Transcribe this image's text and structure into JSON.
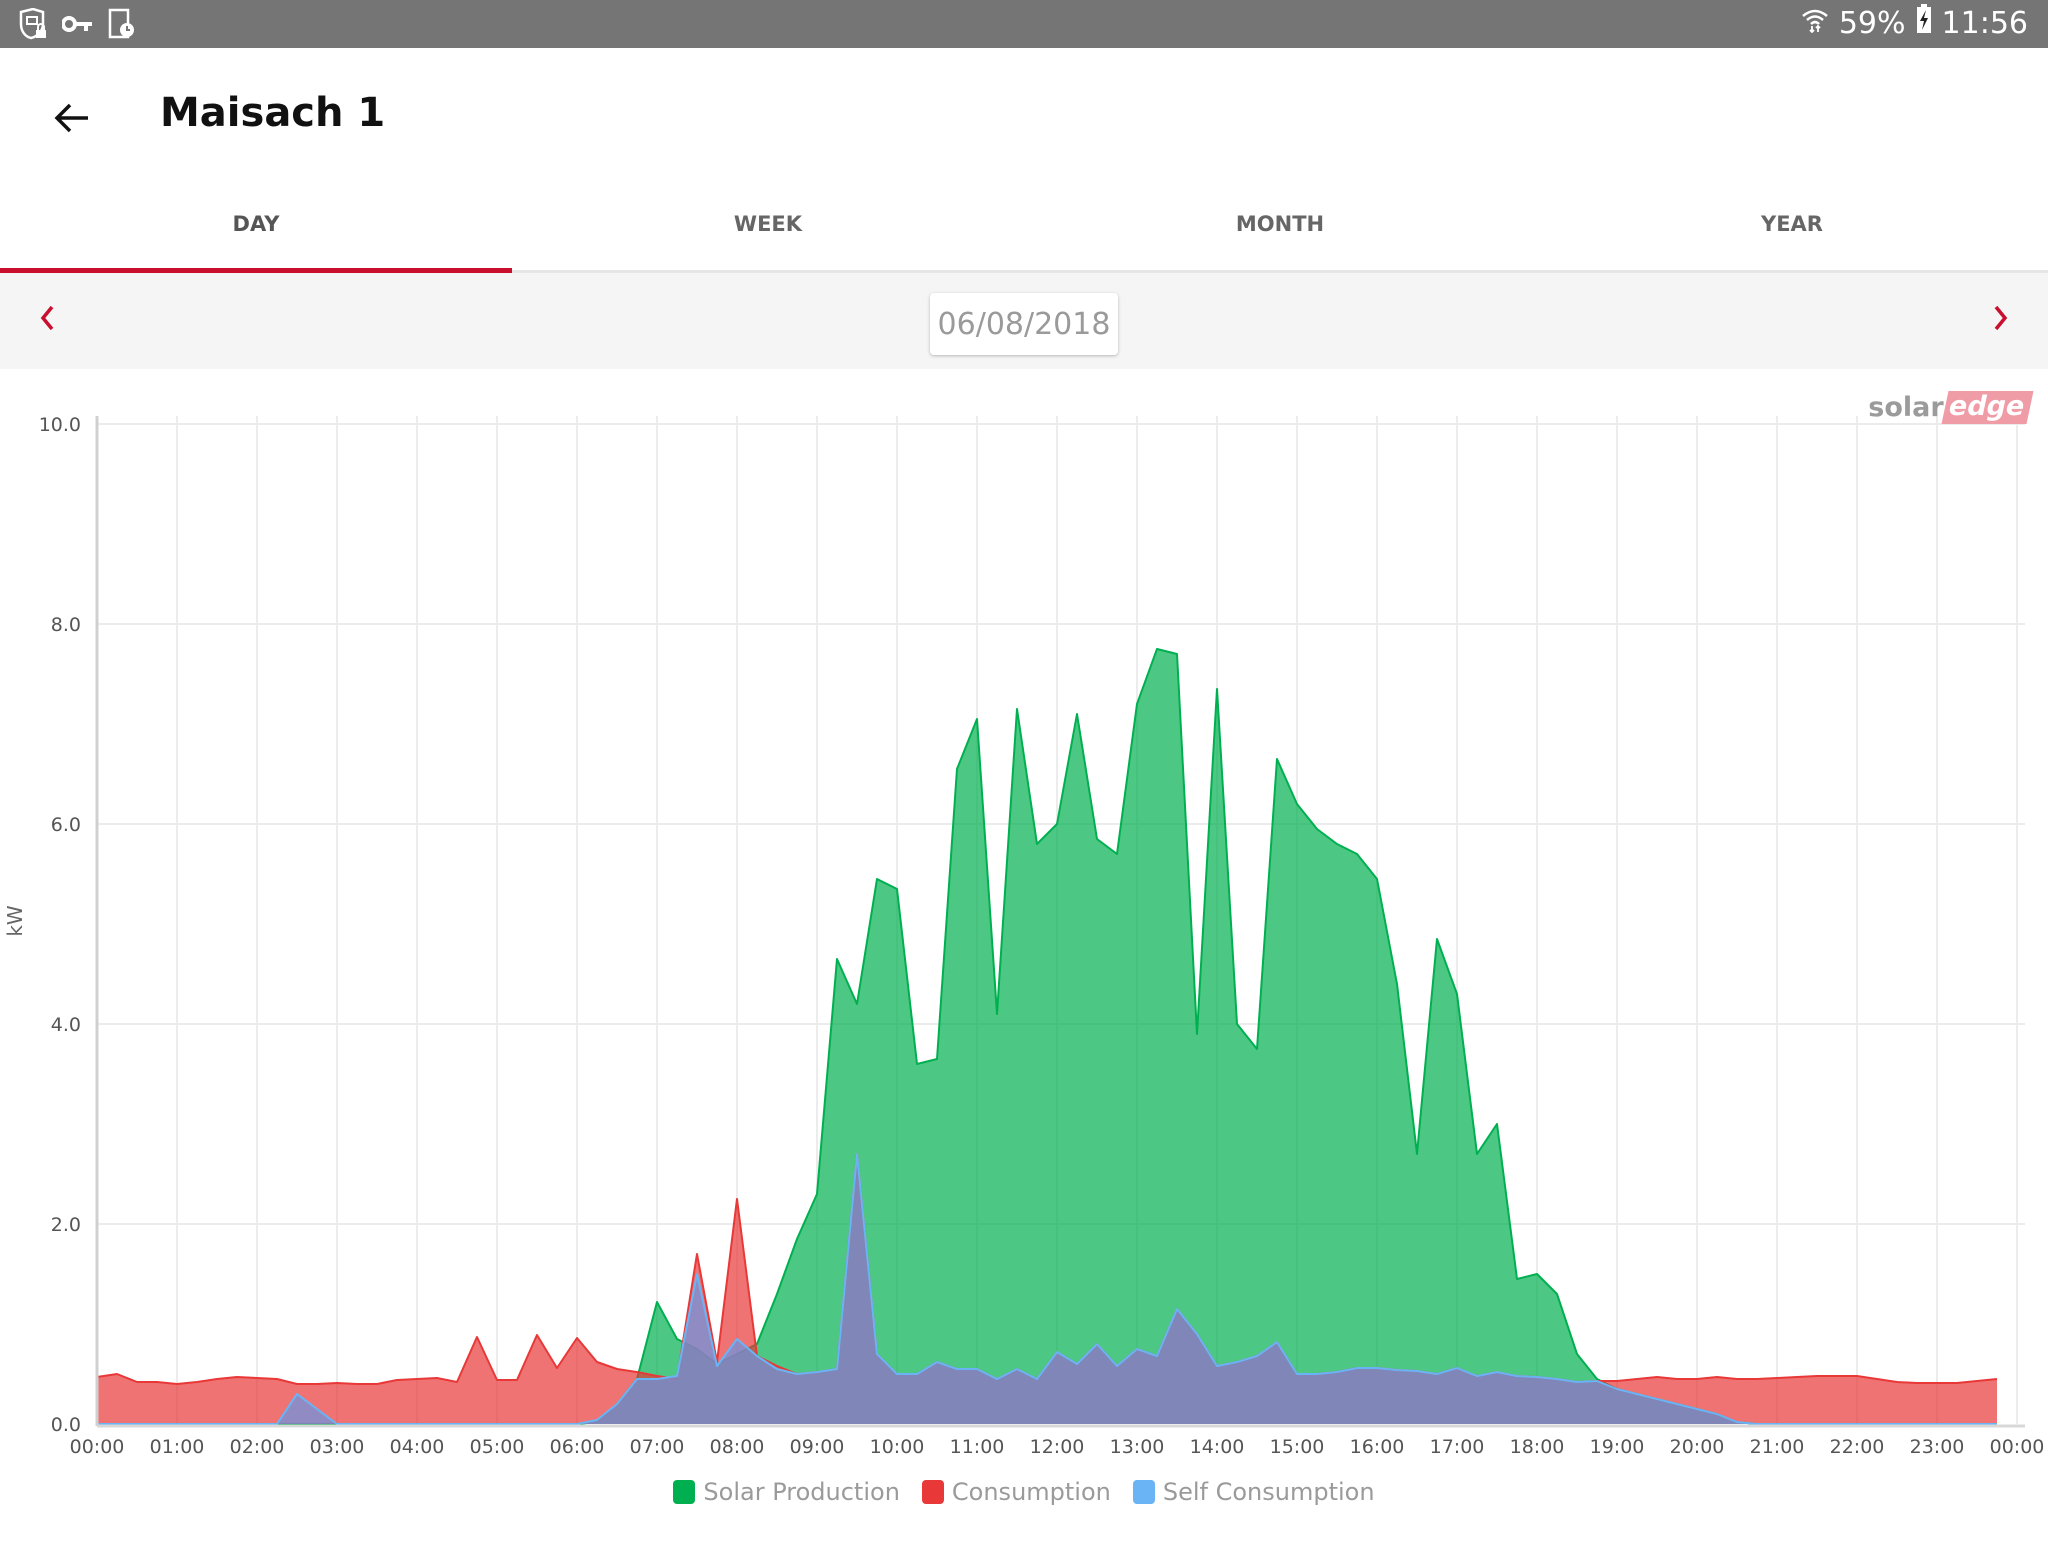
{
  "status_bar": {
    "left_icons": [
      "vpn-shield-lock-icon",
      "key-icon",
      "device-clock-icon"
    ],
    "wifi_icon": "wifi-icon",
    "battery_percent": "59%",
    "battery_icon": "battery-charging-icon",
    "time": "11:56"
  },
  "app_bar": {
    "back_icon": "arrow-left-icon",
    "title": "Maisach 1"
  },
  "tabs": [
    {
      "label": "DAY",
      "active": true
    },
    {
      "label": "WEEK",
      "active": false
    },
    {
      "label": "MONTH",
      "active": false
    },
    {
      "label": "YEAR",
      "active": false
    }
  ],
  "date_nav": {
    "prev_icon": "chevron-left-icon",
    "next_icon": "chevron-right-icon",
    "date": "06/08/2018"
  },
  "colors": {
    "accent": "#c8102e",
    "solar": "#00b050",
    "consumption": "#e83838",
    "self_consumption": "#6ab4f5"
  },
  "logo": {
    "part1": "solar",
    "part2": "edge"
  },
  "chart_data": {
    "type": "area",
    "title": "",
    "xlabel": "",
    "ylabel": "kW",
    "ylim": [
      0,
      10
    ],
    "yticks": [
      "0.0",
      "2.0",
      "4.0",
      "6.0",
      "8.0",
      "10.0"
    ],
    "ytick_values": [
      0,
      2,
      4,
      6,
      8,
      10
    ],
    "xticks": [
      "00:00",
      "01:00",
      "02:00",
      "03:00",
      "04:00",
      "05:00",
      "06:00",
      "07:00",
      "08:00",
      "09:00",
      "10:00",
      "11:00",
      "12:00",
      "13:00",
      "14:00",
      "15:00",
      "16:00",
      "17:00",
      "18:00",
      "19:00",
      "20:00",
      "21:00",
      "22:00",
      "23:00",
      "00:00"
    ],
    "x_interval_minutes": 15,
    "grid": true,
    "legend_position": "bottom",
    "series": [
      {
        "name": "Solar Production",
        "color": "#00b050",
        "values": [
          0,
          0,
          0,
          0,
          0,
          0,
          0,
          0,
          0,
          0,
          0,
          0,
          0,
          0,
          0,
          0,
          0,
          0,
          0,
          0,
          0,
          0,
          0,
          0,
          0,
          0.02,
          0.2,
          0.45,
          1.22,
          0.85,
          0.75,
          0.6,
          0.7,
          0.8,
          1.3,
          1.85,
          2.3,
          4.65,
          4.2,
          5.45,
          5.35,
          3.6,
          3.65,
          6.55,
          7.05,
          4.1,
          7.15,
          5.8,
          6.0,
          7.1,
          5.85,
          5.7,
          7.2,
          7.75,
          7.7,
          3.9,
          7.35,
          4.0,
          3.75,
          6.65,
          6.2,
          5.95,
          5.8,
          5.7,
          5.45,
          4.4,
          2.7,
          4.85,
          4.3,
          2.7,
          3.0,
          1.45,
          1.5,
          1.3,
          0.7,
          0.45,
          0.35,
          0.3,
          0.25,
          0.2,
          0.15,
          0.1,
          0.02,
          0,
          0,
          0,
          0,
          0,
          0,
          0,
          0,
          0
        ]
      },
      {
        "name": "Consumption",
        "color": "#e83838",
        "values": [
          0.47,
          0.5,
          0.42,
          0.42,
          0.4,
          0.42,
          0.45,
          0.47,
          0.46,
          0.45,
          0.4,
          0.4,
          0.41,
          0.4,
          0.4,
          0.44,
          0.45,
          0.46,
          0.42,
          0.87,
          0.44,
          0.44,
          0.89,
          0.56,
          0.86,
          0.62,
          0.55,
          0.52,
          0.48,
          0.45,
          1.7,
          0.62,
          2.25,
          0.68,
          0.58,
          0.5,
          0.52,
          0.55,
          2.7,
          0.7,
          0.5,
          0.5,
          0.62,
          0.55,
          0.55,
          0.45,
          0.55,
          0.45,
          0.72,
          0.6,
          0.8,
          0.58,
          0.75,
          0.68,
          1.15,
          0.9,
          0.58,
          0.62,
          0.68,
          0.82,
          0.5,
          0.5,
          0.52,
          0.56,
          0.56,
          0.54,
          0.53,
          0.5,
          0.56,
          0.48,
          0.52,
          0.48,
          0.47,
          0.45,
          0.42,
          0.43,
          0.43,
          0.45,
          0.47,
          0.45,
          0.45,
          0.47,
          0.45,
          0.45,
          0.46,
          0.47,
          0.48,
          0.48,
          0.48,
          0.45,
          0.42,
          0.41,
          0.41,
          0.41,
          0.43,
          0.45
        ]
      },
      {
        "name": "Self Consumption",
        "color": "#6ab4f5",
        "values": [
          0,
          0,
          0,
          0,
          0,
          0,
          0,
          0,
          0,
          0,
          0.3,
          0.15,
          0,
          0,
          0,
          0,
          0,
          0,
          0,
          0,
          0,
          0,
          0,
          0,
          0,
          0.04,
          0.2,
          0.45,
          0.45,
          0.48,
          1.5,
          0.58,
          0.85,
          0.68,
          0.55,
          0.5,
          0.52,
          0.55,
          2.7,
          0.7,
          0.5,
          0.5,
          0.62,
          0.55,
          0.55,
          0.45,
          0.55,
          0.45,
          0.72,
          0.6,
          0.8,
          0.58,
          0.75,
          0.68,
          1.15,
          0.9,
          0.58,
          0.62,
          0.68,
          0.82,
          0.5,
          0.5,
          0.52,
          0.56,
          0.56,
          0.54,
          0.53,
          0.5,
          0.56,
          0.48,
          0.52,
          0.48,
          0.47,
          0.45,
          0.42,
          0.43,
          0.35,
          0.3,
          0.25,
          0.2,
          0.15,
          0.1,
          0.02,
          0,
          0,
          0,
          0,
          0,
          0,
          0,
          0,
          0,
          0,
          0,
          0,
          0
        ]
      }
    ]
  },
  "legend": [
    {
      "label": "Solar Production",
      "color": "#00b050"
    },
    {
      "label": "Consumption",
      "color": "#e83838"
    },
    {
      "label": "Self Consumption",
      "color": "#6ab4f5"
    }
  ]
}
